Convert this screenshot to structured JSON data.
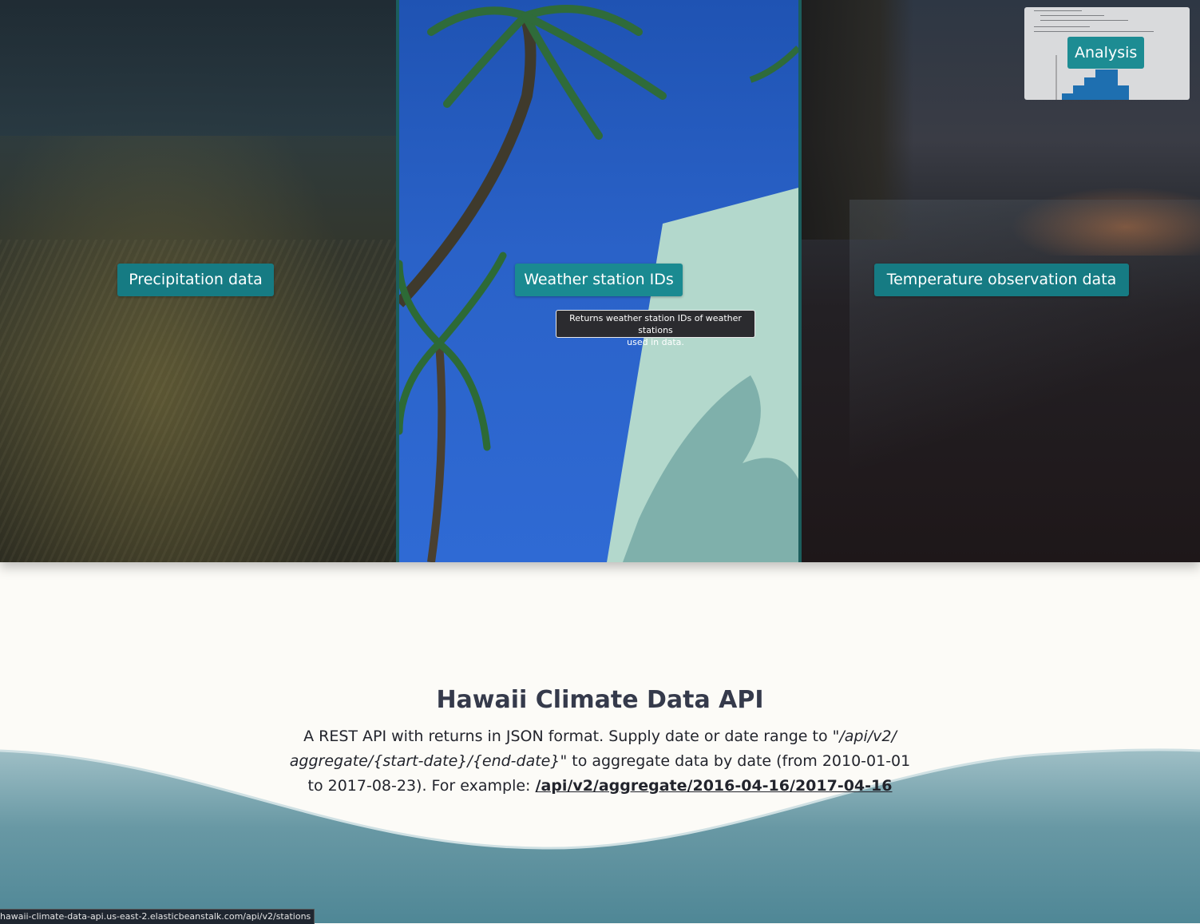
{
  "panels": {
    "precipitation_label": "Precipitation data",
    "stations_label": "Weather station IDs",
    "temperature_label": "Temperature observation data",
    "stations_tooltip_line1": "Returns weather station IDs of weather stations",
    "stations_tooltip_line2": "used in data."
  },
  "analysis": {
    "label": "Analysis"
  },
  "main": {
    "title": "Hawaii Climate Data API",
    "desc_part1": "A REST API with returns in JSON format. Supply date or date range to ",
    "desc_route": "\"/api/v2/ aggregate/{start-date}/{end-date}\"",
    "desc_part2": " to aggregate data by date (from 2010-01-01 to 2017-08-23). For example: ",
    "example_link": "/api/v2/aggregate/2016-04-16/2017-04-16"
  },
  "status_bar": {
    "url": "hawaii-climate-data-api.us-east-2.elasticbeanstalk.com/api/v2/stations"
  },
  "colors": {
    "button": "#167b83",
    "wave_top": "#9fbfc6",
    "wave_bottom": "#4f8796",
    "background": "#fcfbf7"
  }
}
